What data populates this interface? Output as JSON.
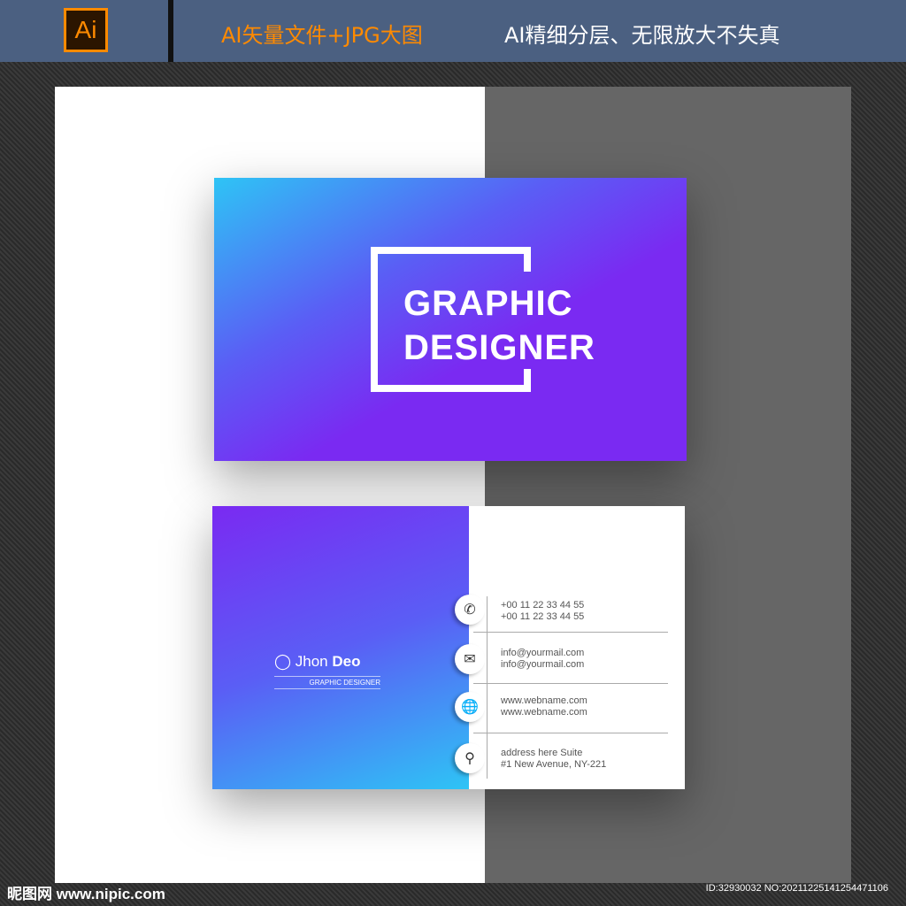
{
  "header": {
    "logo": "Ai",
    "title_orange": "AI矢量文件+JPG大图",
    "title_white": "AI精细分层、无限放大不失真"
  },
  "front_card": {
    "line1": "GRAPHIC",
    "line2": "DESIGNER"
  },
  "back_card": {
    "first_name": "Jhon",
    "last_name": "Deo",
    "role": "GRAPHIC DESIGNER",
    "contacts": [
      {
        "icon": "phone-icon",
        "line1": "+00 11 22 33 44 55",
        "line2": "+00 11 22 33 44 55"
      },
      {
        "icon": "mail-icon",
        "line1": "info@yourmail.com",
        "line2": "info@yourmail.com"
      },
      {
        "icon": "globe-icon",
        "line1": "www.webname.com",
        "line2": "www.webname.com"
      },
      {
        "icon": "location-icon",
        "line1": "address here Suite",
        "line2": "#1 New Avenue, NY-221"
      }
    ]
  },
  "watermark": {
    "site": "昵图网 www.nipic.com",
    "id": "ID:32930032 NO:20211225141254471106"
  }
}
